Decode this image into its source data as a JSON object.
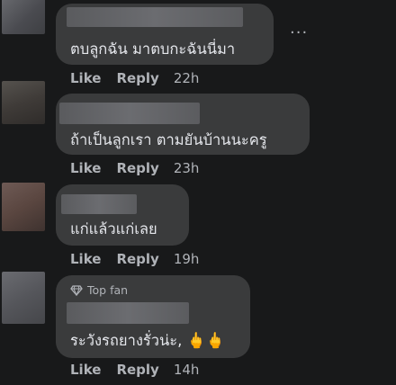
{
  "comments": [
    {
      "text": "ตบลูกฉัน มาตบกะฉันนี่มา",
      "actions": {
        "like": "Like",
        "reply": "Reply",
        "time": "22h"
      }
    },
    {
      "text": "ถ้าเป็นลูกเรา ตามยันบ้านนะครู",
      "actions": {
        "like": "Like",
        "reply": "Reply",
        "time": "23h"
      }
    },
    {
      "text": "แก่แล้วแก่เลย",
      "actions": {
        "like": "Like",
        "reply": "Reply",
        "time": "19h"
      }
    },
    {
      "badge": "Top fan",
      "text": "ระวังรถยางรั่วน่ะ,",
      "emoji": "🖕🖕",
      "actions": {
        "like": "Like",
        "reply": "Reply",
        "time": "14h"
      }
    }
  ],
  "more_label": "···",
  "colors": {
    "background": "#18191a",
    "bubble": "#3a3b3c",
    "text": "#e4e6eb",
    "secondary": "#b0b3b8"
  },
  "icons": {
    "more": "more-options-icon",
    "badge": "diamond-icon"
  }
}
